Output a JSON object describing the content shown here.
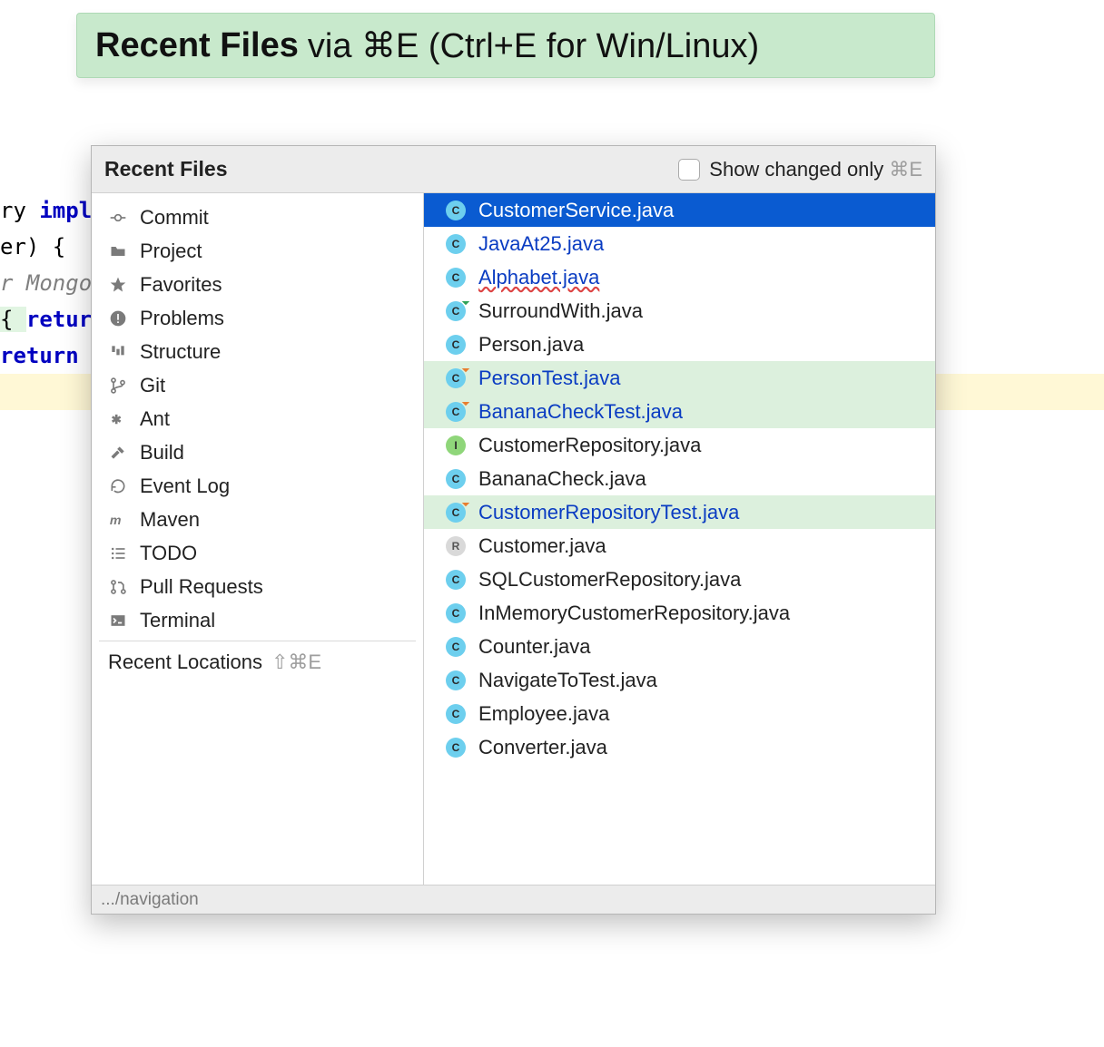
{
  "banner": {
    "strong": "Recent Files",
    "rest": " via ⌘E (Ctrl+E for Win/Linux)"
  },
  "editor": {
    "line1_a": "ry ",
    "line1_b": "impl",
    "line2": "",
    "line3": "er) {",
    "line4": "r Mongo",
    "line5": "",
    "line6": "",
    "line7_a": "{ ",
    "line7_b": "return",
    "line8": "",
    "line9": "",
    "line10": "return"
  },
  "popup": {
    "title": "Recent Files",
    "show_changed": "Show changed only",
    "header_shortcut": "⌘E",
    "recent_locations": "Recent Locations",
    "locations_shortcut": "⇧⌘E",
    "footer": ".../navigation"
  },
  "tools": [
    {
      "label": "Commit",
      "icon": "commit"
    },
    {
      "label": "Project",
      "icon": "folder"
    },
    {
      "label": "Favorites",
      "icon": "star"
    },
    {
      "label": "Problems",
      "icon": "alert"
    },
    {
      "label": "Structure",
      "icon": "structure"
    },
    {
      "label": "Git",
      "icon": "branch"
    },
    {
      "label": "Ant",
      "icon": "ant"
    },
    {
      "label": "Build",
      "icon": "hammer"
    },
    {
      "label": "Event Log",
      "icon": "log"
    },
    {
      "label": "Maven",
      "icon": "maven"
    },
    {
      "label": "TODO",
      "icon": "list"
    },
    {
      "label": "Pull Requests",
      "icon": "pr"
    },
    {
      "label": "Terminal",
      "icon": "terminal"
    }
  ],
  "files": [
    {
      "name": "CustomerService.java",
      "selected": true,
      "icon": {
        "letter": "C",
        "color": "c-blue"
      }
    },
    {
      "name": "JavaAt25.java",
      "link": true,
      "icon": {
        "letter": "C",
        "color": "c-blue"
      }
    },
    {
      "name": "Alphabet.java",
      "link": true,
      "wavy": true,
      "icon": {
        "letter": "C",
        "color": "c-blue"
      }
    },
    {
      "name": "SurroundWith.java",
      "icon": {
        "letter": "C",
        "color": "c-blue",
        "badge": "g"
      }
    },
    {
      "name": "Person.java",
      "icon": {
        "letter": "C",
        "color": "c-blue"
      }
    },
    {
      "name": "PersonTest.java",
      "highlight": true,
      "link": true,
      "icon": {
        "letter": "C",
        "color": "c-blue",
        "badge": "o"
      }
    },
    {
      "name": "BananaCheckTest.java",
      "highlight": true,
      "link": true,
      "icon": {
        "letter": "C",
        "color": "c-blue",
        "badge": "o"
      }
    },
    {
      "name": "CustomerRepository.java",
      "icon": {
        "letter": "I",
        "color": "c-green"
      }
    },
    {
      "name": "BananaCheck.java",
      "icon": {
        "letter": "C",
        "color": "c-blue"
      }
    },
    {
      "name": "CustomerRepositoryTest.java",
      "highlight": true,
      "link": true,
      "icon": {
        "letter": "C",
        "color": "c-blue",
        "badge": "o"
      }
    },
    {
      "name": "Customer.java",
      "icon": {
        "letter": "R",
        "color": "c-gray"
      }
    },
    {
      "name": "SQLCustomerRepository.java",
      "icon": {
        "letter": "C",
        "color": "c-blue"
      }
    },
    {
      "name": "InMemoryCustomerRepository.java",
      "icon": {
        "letter": "C",
        "color": "c-blue"
      }
    },
    {
      "name": "Counter.java",
      "icon": {
        "letter": "C",
        "color": "c-blue"
      }
    },
    {
      "name": "NavigateToTest.java",
      "icon": {
        "letter": "C",
        "color": "c-blue"
      }
    },
    {
      "name": "Employee.java",
      "icon": {
        "letter": "C",
        "color": "c-blue"
      }
    },
    {
      "name": "Converter.java",
      "icon": {
        "letter": "C",
        "color": "c-blue"
      }
    }
  ]
}
